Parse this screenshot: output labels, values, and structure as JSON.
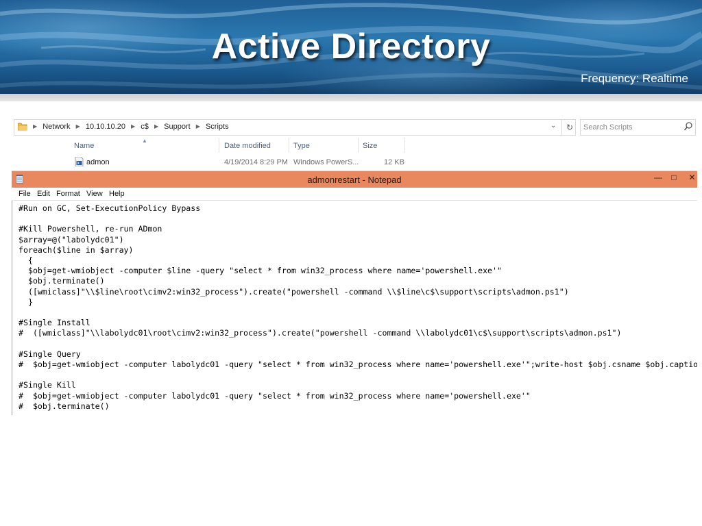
{
  "slide": {
    "title": "Active Directory",
    "frequency": "Frequency: Realtime"
  },
  "explorer": {
    "breadcrumb": [
      "Network",
      "10.10.10.20",
      "c$",
      "Support",
      "Scripts"
    ],
    "search_placeholder": "Search Scripts",
    "columns": [
      "Name",
      "Date modified",
      "Type",
      "Size"
    ],
    "files": [
      {
        "name": "admon",
        "date_modified": "4/19/2014 8:29 PM",
        "type": "Windows PowerS...",
        "size": "12 KB"
      }
    ]
  },
  "notepad": {
    "title": "admonrestart - Notepad",
    "menu": [
      "File",
      "Edit",
      "Format",
      "View",
      "Help"
    ],
    "lines": [
      "#Run on GC, Set-ExecutionPolicy Bypass",
      "",
      "#Kill Powershell, re-run ADmon",
      "$array=@(\"labolydc01\")",
      "foreach($line in $array)",
      "  {",
      "  $obj=get-wmiobject -computer $line -query \"select * from win32_process where name='powershell.exe'\"",
      "  $obj.terminate()",
      "  ([wmiclass]\"\\\\$line\\root\\cimv2:win32_process\").create(\"powershell -command \\\\$line\\c$\\support\\scripts\\admon.ps1\")",
      "  }",
      "",
      "#Single Install",
      "#  ([wmiclass]\"\\\\labolydc01\\root\\cimv2:win32_process\").create(\"powershell -command \\\\labolydc01\\c$\\support\\scripts\\admon.ps1\")",
      "",
      "#Single Query",
      "#  $obj=get-wmiobject -computer labolydc01 -query \"select * from win32_process where name='powershell.exe'\";write-host $obj.csname $obj.caption",
      "",
      "#Single Kill",
      "#  $obj=get-wmiobject -computer labolydc01 -query \"select * from win32_process where name='powershell.exe'\"",
      "#  $obj.terminate()"
    ]
  },
  "colors": {
    "notepad_titlebar": "#e9875e",
    "banner_blue": "#2a78b0",
    "header_text": "#4c607a"
  },
  "icons": {
    "address_bar": "folder-icon",
    "search": "search-icon",
    "file": "powershell-file-icon",
    "notepad": "notepad-icon"
  }
}
